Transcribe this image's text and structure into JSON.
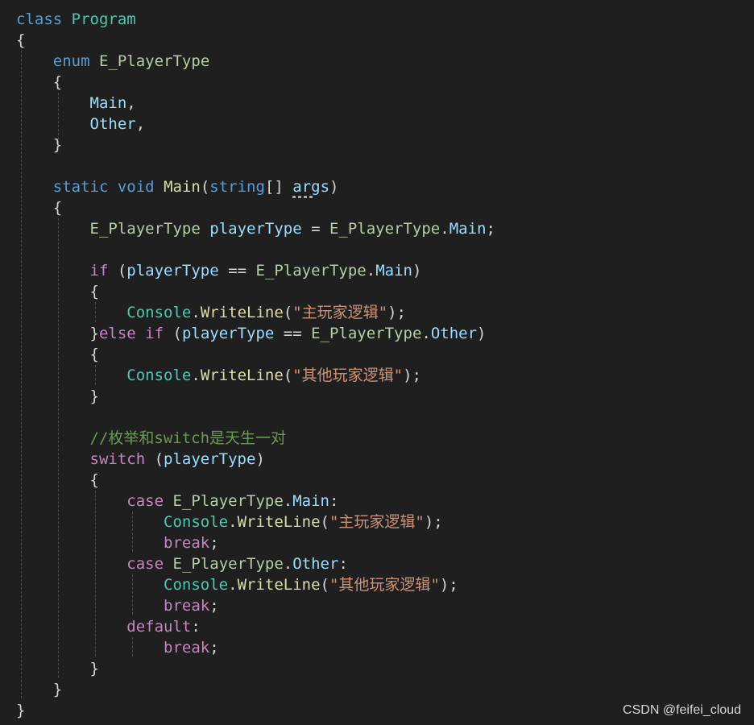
{
  "palette": {
    "keyword": "#569cd6",
    "control": "#c586c0",
    "type": "#4ec9b0",
    "enum_type": "#b5cea8",
    "method": "#dcdcaa",
    "variable": "#9cdcfe",
    "string": "#ce9178",
    "comment": "#6a9955",
    "punct": "#d4d4d4",
    "background": "#1f1f1f"
  },
  "code": {
    "lines": [
      [
        [
          "class",
          "keyword"
        ],
        [
          " ",
          "punct"
        ],
        [
          "Program",
          "type"
        ]
      ],
      [
        [
          "{",
          "punct"
        ]
      ],
      [
        [
          "    ",
          "punct"
        ],
        [
          "enum",
          "keyword"
        ],
        [
          " ",
          "punct"
        ],
        [
          "E_PlayerType",
          "enum_type"
        ]
      ],
      [
        [
          "    {",
          "punct"
        ]
      ],
      [
        [
          "        ",
          "punct"
        ],
        [
          "Main",
          "variable"
        ],
        [
          ",",
          "punct"
        ]
      ],
      [
        [
          "        ",
          "punct"
        ],
        [
          "Other",
          "variable"
        ],
        [
          ",",
          "punct"
        ]
      ],
      [
        [
          "    }",
          "punct"
        ]
      ],
      [],
      [
        [
          "    ",
          "punct"
        ],
        [
          "static",
          "keyword"
        ],
        [
          " ",
          "punct"
        ],
        [
          "void",
          "keyword"
        ],
        [
          " ",
          "punct"
        ],
        [
          "Main",
          "method"
        ],
        [
          "(",
          "punct"
        ],
        [
          "string",
          "keyword"
        ],
        [
          "[] ",
          "punct"
        ],
        [
          "args",
          "variable"
        ],
        [
          ")",
          "punct"
        ]
      ],
      [
        [
          "    {",
          "punct"
        ]
      ],
      [
        [
          "        ",
          "punct"
        ],
        [
          "E_PlayerType",
          "enum_type"
        ],
        [
          " ",
          "punct"
        ],
        [
          "playerType",
          "variable"
        ],
        [
          " = ",
          "punct"
        ],
        [
          "E_PlayerType",
          "enum_type"
        ],
        [
          ".",
          "punct"
        ],
        [
          "Main",
          "variable"
        ],
        [
          ";",
          "punct"
        ]
      ],
      [],
      [
        [
          "        ",
          "punct"
        ],
        [
          "if",
          "control"
        ],
        [
          " (",
          "punct"
        ],
        [
          "playerType",
          "variable"
        ],
        [
          " == ",
          "punct"
        ],
        [
          "E_PlayerType",
          "enum_type"
        ],
        [
          ".",
          "punct"
        ],
        [
          "Main",
          "variable"
        ],
        [
          ")",
          "punct"
        ]
      ],
      [
        [
          "        {",
          "punct"
        ]
      ],
      [
        [
          "            ",
          "punct"
        ],
        [
          "Console",
          "type"
        ],
        [
          ".",
          "punct"
        ],
        [
          "WriteLine",
          "method"
        ],
        [
          "(",
          "punct"
        ],
        [
          "\"主玩家逻辑\"",
          "string"
        ],
        [
          ");",
          "punct"
        ]
      ],
      [
        [
          "        }",
          "punct"
        ],
        [
          "else",
          "control"
        ],
        [
          " ",
          "punct"
        ],
        [
          "if",
          "control"
        ],
        [
          " (",
          "punct"
        ],
        [
          "playerType",
          "variable"
        ],
        [
          " == ",
          "punct"
        ],
        [
          "E_PlayerType",
          "enum_type"
        ],
        [
          ".",
          "punct"
        ],
        [
          "Other",
          "variable"
        ],
        [
          ")",
          "punct"
        ]
      ],
      [
        [
          "        {",
          "punct"
        ]
      ],
      [
        [
          "            ",
          "punct"
        ],
        [
          "Console",
          "type"
        ],
        [
          ".",
          "punct"
        ],
        [
          "WriteLine",
          "method"
        ],
        [
          "(",
          "punct"
        ],
        [
          "\"其他玩家逻辑\"",
          "string"
        ],
        [
          ");",
          "punct"
        ]
      ],
      [
        [
          "        }",
          "punct"
        ]
      ],
      [],
      [
        [
          "        ",
          "punct"
        ],
        [
          "//枚举和switch是天生一对",
          "comment"
        ]
      ],
      [
        [
          "        ",
          "punct"
        ],
        [
          "switch",
          "control"
        ],
        [
          " (",
          "punct"
        ],
        [
          "playerType",
          "variable"
        ],
        [
          ")",
          "punct"
        ]
      ],
      [
        [
          "        {",
          "punct"
        ]
      ],
      [
        [
          "            ",
          "punct"
        ],
        [
          "case",
          "control"
        ],
        [
          " ",
          "punct"
        ],
        [
          "E_PlayerType",
          "enum_type"
        ],
        [
          ".",
          "punct"
        ],
        [
          "Main",
          "variable"
        ],
        [
          ":",
          "punct"
        ]
      ],
      [
        [
          "                ",
          "punct"
        ],
        [
          "Console",
          "type"
        ],
        [
          ".",
          "punct"
        ],
        [
          "WriteLine",
          "method"
        ],
        [
          "(",
          "punct"
        ],
        [
          "\"主玩家逻辑\"",
          "string"
        ],
        [
          ");",
          "punct"
        ]
      ],
      [
        [
          "                ",
          "punct"
        ],
        [
          "break",
          "control"
        ],
        [
          ";",
          "punct"
        ]
      ],
      [
        [
          "            ",
          "punct"
        ],
        [
          "case",
          "control"
        ],
        [
          " ",
          "punct"
        ],
        [
          "E_PlayerType",
          "enum_type"
        ],
        [
          ".",
          "punct"
        ],
        [
          "Other",
          "variable"
        ],
        [
          ":",
          "punct"
        ]
      ],
      [
        [
          "                ",
          "punct"
        ],
        [
          "Console",
          "type"
        ],
        [
          ".",
          "punct"
        ],
        [
          "WriteLine",
          "method"
        ],
        [
          "(",
          "punct"
        ],
        [
          "\"其他玩家逻辑\"",
          "string"
        ],
        [
          ");",
          "punct"
        ]
      ],
      [
        [
          "                ",
          "punct"
        ],
        [
          "break",
          "control"
        ],
        [
          ";",
          "punct"
        ]
      ],
      [
        [
          "            ",
          "punct"
        ],
        [
          "default",
          "control"
        ],
        [
          ":",
          "punct"
        ]
      ],
      [
        [
          "                ",
          "punct"
        ],
        [
          "break",
          "control"
        ],
        [
          ";",
          "punct"
        ]
      ],
      [
        [
          "        }",
          "punct"
        ]
      ],
      [
        [
          "    }",
          "punct"
        ]
      ],
      [
        [
          "}",
          "punct"
        ]
      ]
    ]
  },
  "watermark": "CSDN @feifei_cloud"
}
